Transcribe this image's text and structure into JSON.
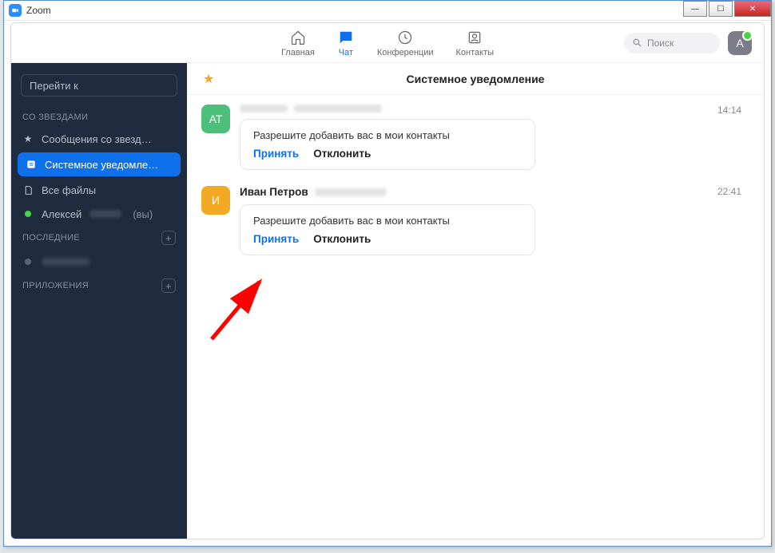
{
  "window": {
    "title": "Zoom"
  },
  "topbar": {
    "nav": {
      "home": "Главная",
      "chat": "Чат",
      "conf": "Конференции",
      "contacts": "Контакты"
    },
    "search_placeholder": "Поиск",
    "avatar_letter": "A"
  },
  "sidebar": {
    "jump_to": "Перейти к",
    "starred_label": "СО ЗВЕЗДАМИ",
    "items": {
      "starred_msgs": "Сообщения со звезд…",
      "system_notif": "Системное уведомле…",
      "all_files": "Все файлы",
      "user_me": "Алексей",
      "you_suffix": "(вы)"
    },
    "recent_label": "ПОСЛЕДНИЕ",
    "apps_label": "ПРИЛОЖЕНИЯ"
  },
  "main": {
    "title": "Системное уведомление",
    "messages": [
      {
        "avatar": "AT",
        "name_hidden": true,
        "time": "14:14",
        "request_text": "Разрешите добавить вас в мои контакты",
        "accept": "Принять",
        "decline": "Отклонить"
      },
      {
        "avatar": "И",
        "name": "Иван Петров",
        "time": "22:41",
        "request_text": "Разрешите добавить вас в мои контакты",
        "accept": "Принять",
        "decline": "Отклонить"
      }
    ]
  }
}
